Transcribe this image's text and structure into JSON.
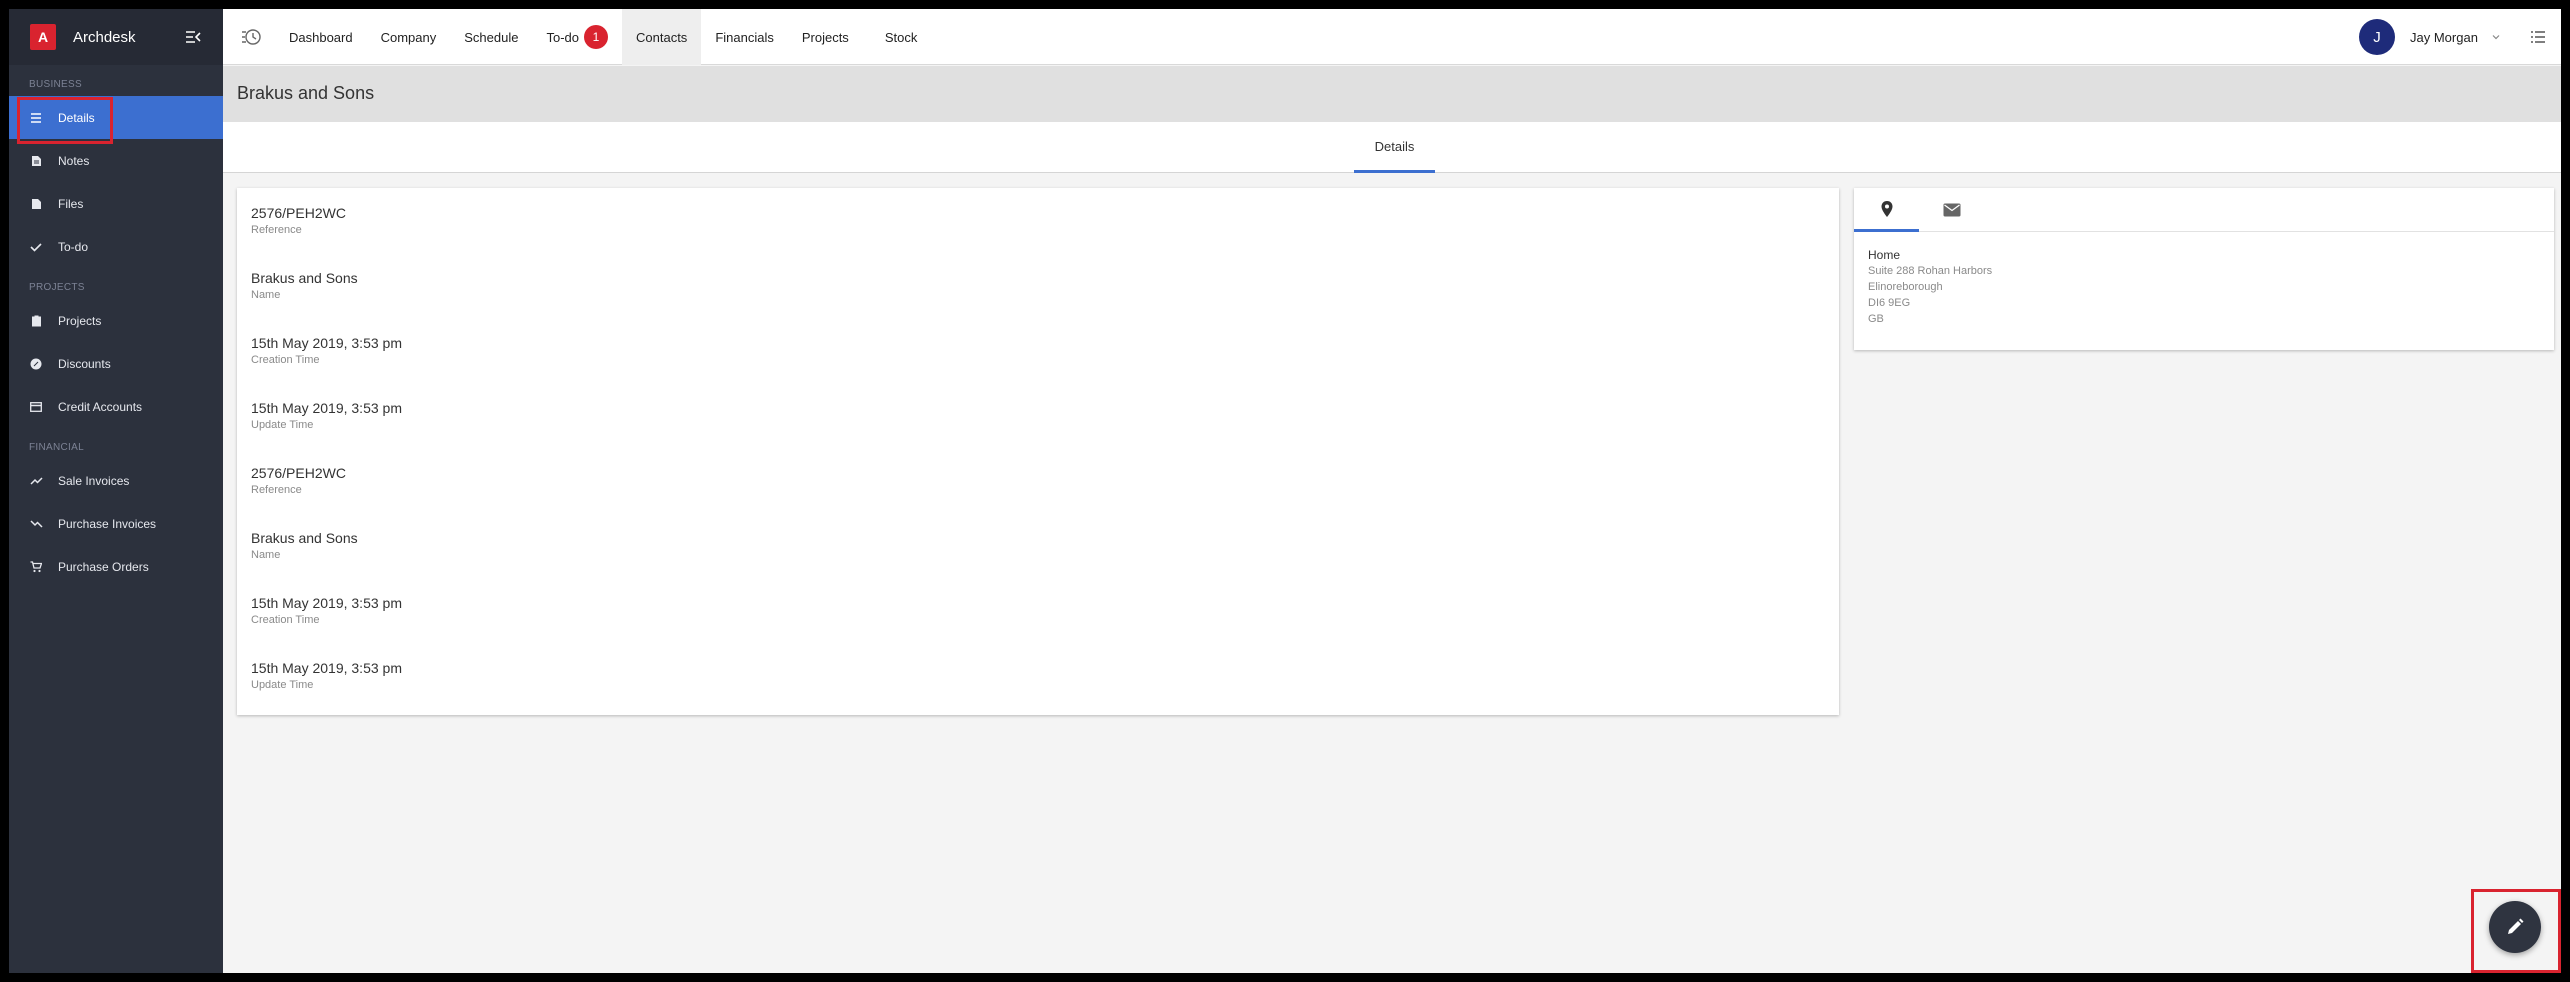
{
  "app": {
    "logo_letter": "A",
    "name": "Archdesk"
  },
  "sidebar": {
    "sections": [
      {
        "label": "BUSINESS",
        "items": [
          {
            "label": "Details",
            "icon": "list-icon",
            "active": true
          },
          {
            "label": "Notes",
            "icon": "note-icon"
          },
          {
            "label": "Files",
            "icon": "file-icon"
          },
          {
            "label": "To-do",
            "icon": "check-icon"
          }
        ]
      },
      {
        "label": "PROJECTS",
        "items": [
          {
            "label": "Projects",
            "icon": "clipboard-icon"
          },
          {
            "label": "Discounts",
            "icon": "discount-icon"
          },
          {
            "label": "Credit Accounts",
            "icon": "credit-card-icon"
          }
        ]
      },
      {
        "label": "FINANCIAL",
        "items": [
          {
            "label": "Sale Invoices",
            "icon": "trending-up-icon"
          },
          {
            "label": "Purchase Invoices",
            "icon": "trending-down-icon"
          },
          {
            "label": "Purchase Orders",
            "icon": "cart-icon"
          }
        ]
      }
    ]
  },
  "topnav": {
    "items": [
      {
        "label": "Dashboard"
      },
      {
        "label": "Company"
      },
      {
        "label": "Schedule"
      },
      {
        "label": "To-do",
        "badge": "1"
      },
      {
        "label": "Contacts",
        "active": true
      },
      {
        "label": "Financials"
      },
      {
        "label": "Projects"
      },
      {
        "label": "Stock"
      }
    ],
    "user": {
      "initial": "J",
      "name": "Jay Morgan"
    }
  },
  "page": {
    "title": "Brakus and Sons",
    "tab": "Details"
  },
  "details": [
    {
      "value": "2576/PEH2WC",
      "label": "Reference"
    },
    {
      "value": "Brakus and Sons",
      "label": "Name"
    },
    {
      "value": "15th May 2019, 3:53 pm",
      "label": "Creation Time"
    },
    {
      "value": "15th May 2019, 3:53 pm",
      "label": "Update Time"
    },
    {
      "value": "2576/PEH2WC",
      "label": "Reference"
    },
    {
      "value": "Brakus and Sons",
      "label": "Name"
    },
    {
      "value": "15th May 2019, 3:53 pm",
      "label": "Creation Time"
    },
    {
      "value": "15th May 2019, 3:53 pm",
      "label": "Update Time"
    }
  ],
  "address": {
    "title": "Home",
    "lines": [
      "Suite 288 Rohan Harbors",
      "Elinoreborough",
      "DI6 9EG",
      "GB"
    ]
  },
  "colors": {
    "accent": "#3c6fd0",
    "brand_red": "#d9232f",
    "sidebar_bg": "#2c313d",
    "avatar": "#1e2b7a"
  }
}
